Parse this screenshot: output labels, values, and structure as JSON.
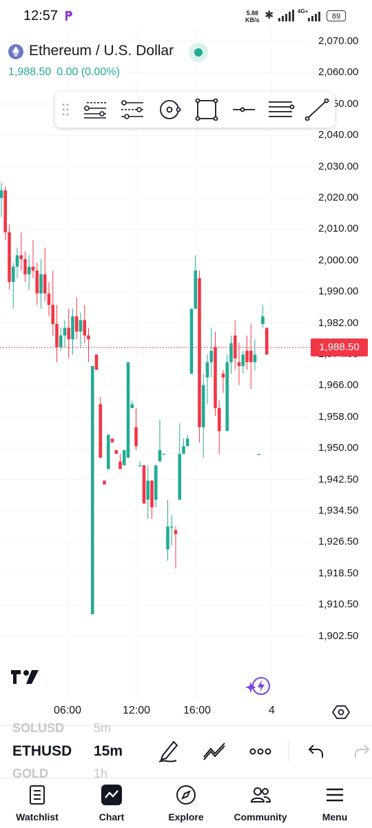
{
  "status_bar": {
    "time": "12:57",
    "net_speed_value": "5.88",
    "net_speed_unit": "KB/s",
    "network_type": "4G+",
    "battery": "89"
  },
  "header": {
    "symbol_title": "Ethereum / U.S. Dollar",
    "price": "1,988.50",
    "change": "0.00 (0.00%)"
  },
  "price_axis": {
    "labels": [
      "2,070.00",
      "2,060.00",
      "2,050.00",
      "2,040.00",
      "2,030.00",
      "2,020.00",
      "2,010.00",
      "2,000.00",
      "1,990.00",
      "1,982.00",
      "1,974.00",
      "1,966.00",
      "1,958.00",
      "1,950.00",
      "1,942.50",
      "1,934.50",
      "1,926.50",
      "1,918.50",
      "1,910.50",
      "1,902.50"
    ],
    "current_price": "1,988.50"
  },
  "time_axis": {
    "labels": [
      "06:00",
      "12:00",
      "16:00",
      "4"
    ]
  },
  "symbols_list": {
    "prev_symbol": "SOLUSD",
    "prev_timeframe": "5m",
    "active_symbol": "ETHUSD",
    "active_timeframe": "15m",
    "next_symbol": "GOLD",
    "next_timeframe": "1h"
  },
  "bottom_nav": {
    "items": [
      {
        "label": "Watchlist"
      },
      {
        "label": "Chart"
      },
      {
        "label": "Explore"
      },
      {
        "label": "Community"
      },
      {
        "label": "Menu"
      }
    ]
  },
  "colors": {
    "up": "#22ab94",
    "down": "#f23645",
    "grid": "#f0f3fa",
    "text": "#131722"
  },
  "chart_data": {
    "type": "candlestick",
    "ylim": [
      1900,
      2074
    ],
    "candles": [
      {
        "o": 2029,
        "h": 2033,
        "l": 2024,
        "c": 2031
      },
      {
        "o": 2031,
        "h": 2032,
        "l": 2018,
        "c": 2020
      },
      {
        "o": 2020,
        "h": 2022,
        "l": 2005,
        "c": 2007
      },
      {
        "o": 2007,
        "h": 2012,
        "l": 2000,
        "c": 2011
      },
      {
        "o": 2011,
        "h": 2016,
        "l": 2008,
        "c": 2014
      },
      {
        "o": 2014,
        "h": 2020,
        "l": 2010,
        "c": 2013
      },
      {
        "o": 2013,
        "h": 2015,
        "l": 2007,
        "c": 2009
      },
      {
        "o": 2009,
        "h": 2014,
        "l": 2005,
        "c": 2011
      },
      {
        "o": 2011,
        "h": 2018,
        "l": 2008,
        "c": 2010
      },
      {
        "o": 2010,
        "h": 2012,
        "l": 2001,
        "c": 2004
      },
      {
        "o": 2004,
        "h": 2013,
        "l": 2000,
        "c": 2009
      },
      {
        "o": 2009,
        "h": 2016,
        "l": 2002,
        "c": 2004
      },
      {
        "o": 2004,
        "h": 2007,
        "l": 1998,
        "c": 2001
      },
      {
        "o": 2001,
        "h": 2010,
        "l": 1993,
        "c": 1996
      },
      {
        "o": 1996,
        "h": 2001,
        "l": 1986,
        "c": 1990
      },
      {
        "o": 1990,
        "h": 1995,
        "l": 1989,
        "c": 1993
      },
      {
        "o": 1993,
        "h": 1997,
        "l": 1990,
        "c": 1995
      },
      {
        "o": 1995,
        "h": 2000,
        "l": 1987,
        "c": 1992
      },
      {
        "o": 1992,
        "h": 2000,
        "l": 1988,
        "c": 1998
      },
      {
        "o": 1998,
        "h": 2003,
        "l": 1992,
        "c": 1994
      },
      {
        "o": 1994,
        "h": 1999,
        "l": 1990,
        "c": 1997
      },
      {
        "o": 1997,
        "h": 2001,
        "l": 1991,
        "c": 1993
      },
      {
        "o": 1993,
        "h": 1995,
        "l": 1986,
        "c": 1992
      },
      {
        "o": 1920,
        "h": 1985,
        "l": 1920,
        "c": 1985
      },
      {
        "o": 1988,
        "h": 1988,
        "l": 1984,
        "c": 1984
      },
      {
        "o": 1975,
        "h": 1977,
        "l": 1961,
        "c": 1961
      },
      {
        "o": 1955,
        "h": 1955,
        "l": 1954,
        "c": 1954
      },
      {
        "o": 1958,
        "h": 1967,
        "l": 1958,
        "c": 1967
      },
      {
        "o": 1966,
        "h": 1966,
        "l": 1965,
        "c": 1965
      },
      {
        "o": 1963,
        "h": 1963,
        "l": 1962,
        "c": 1962
      },
      {
        "o": 1960,
        "h": 1962,
        "l": 1958,
        "c": 1958
      },
      {
        "o": 1959,
        "h": 1963,
        "l": 1959,
        "c": 1963
      },
      {
        "o": 1961,
        "h": 1986,
        "l": 1961,
        "c": 1986
      },
      {
        "o": 1974,
        "h": 1976,
        "l": 1974,
        "c": 1975
      },
      {
        "o": 1969,
        "h": 1974,
        "l": 1963,
        "c": 1964
      },
      {
        "o": 1959,
        "h": 1960,
        "l": 1959,
        "c": 1959
      },
      {
        "o": 1959,
        "h": 1959,
        "l": 1949,
        "c": 1949
      },
      {
        "o": 1950,
        "h": 1959,
        "l": 1945,
        "c": 1955
      },
      {
        "o": 1955,
        "h": 1955,
        "l": 1945,
        "c": 1948
      },
      {
        "o": 1950,
        "h": 1959,
        "l": 1948,
        "c": 1959
      },
      {
        "o": 1960,
        "h": 1971,
        "l": 1960,
        "c": 1963
      },
      {
        "o": 1962,
        "h": 1962,
        "l": 1962,
        "c": 1962
      },
      {
        "o": 1937,
        "h": 1950,
        "l": 1934,
        "c": 1943
      },
      {
        "o": 1943,
        "h": 1946,
        "l": 1938,
        "c": 1943
      },
      {
        "o": 1942,
        "h": 1943,
        "l": 1932,
        "c": 1941
      },
      {
        "o": 1950,
        "h": 1970,
        "l": 1950,
        "c": 1962
      },
      {
        "o": 1962,
        "h": 1966,
        "l": 1962,
        "c": 1964
      },
      {
        "o": 1964,
        "h": 1967,
        "l": 1964,
        "c": 1966
      },
      {
        "o": 1983,
        "h": 2000,
        "l": 1983,
        "c": 2000
      },
      {
        "o": 2000,
        "h": 2014,
        "l": 2000,
        "c": 2010
      },
      {
        "o": 2008,
        "h": 2010,
        "l": 1965,
        "c": 1969
      },
      {
        "o": 1969,
        "h": 1983,
        "l": 1961,
        "c": 1980
      },
      {
        "o": 1982,
        "h": 1988,
        "l": 1975,
        "c": 1986
      },
      {
        "o": 1986,
        "h": 1995,
        "l": 1982,
        "c": 1989
      },
      {
        "o": 1990,
        "h": 1994,
        "l": 1972,
        "c": 1974
      },
      {
        "o": 1974,
        "h": 1976,
        "l": 1962,
        "c": 1968
      },
      {
        "o": 1983,
        "h": 1984,
        "l": 1978,
        "c": 1982
      },
      {
        "o": 1968,
        "h": 1988,
        "l": 1968,
        "c": 1986
      },
      {
        "o": 1986,
        "h": 1993,
        "l": 1983,
        "c": 1991
      },
      {
        "o": 1993,
        "h": 1997,
        "l": 1984,
        "c": 1987
      },
      {
        "o": 1986,
        "h": 1991,
        "l": 1980,
        "c": 1985
      },
      {
        "o": 1985,
        "h": 1989,
        "l": 1983,
        "c": 1988
      },
      {
        "o": 1989,
        "h": 1993,
        "l": 1984,
        "c": 1986
      },
      {
        "o": 1989,
        "h": 1996,
        "l": 1979,
        "c": 1986
      },
      {
        "o": 1986,
        "h": 1992,
        "l": 1984,
        "c": 1988
      },
      {
        "o": 1962,
        "h": 1962,
        "l": 1962,
        "c": 1962
      },
      {
        "o": 1996,
        "h": 2001,
        "l": 1995,
        "c": 1998
      },
      {
        "o": 1995,
        "h": 1995,
        "l": 1988,
        "c": 1988
      }
    ]
  }
}
